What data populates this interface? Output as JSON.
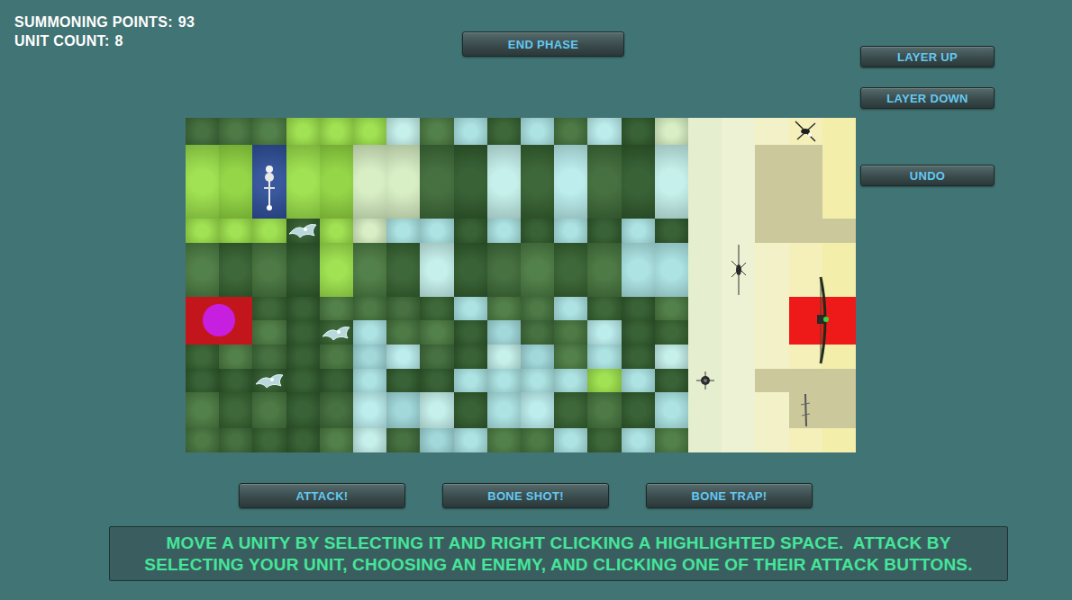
{
  "status": [
    {
      "label": "SUMMONING POINTS:",
      "value": "93"
    },
    {
      "label": "UNIT COUNT:",
      "value": "8"
    }
  ],
  "phase_button": "END PHASE",
  "side_buttons": [
    "LAYER UP",
    "LAYER DOWN",
    "UNDO"
  ],
  "board": {
    "rows": [
      [
        "grass",
        "grass",
        "grass",
        "move",
        "move",
        "move",
        "ice",
        "grass",
        "ice",
        "grass",
        "ice",
        "grass",
        "ice",
        "grass",
        "pale",
        "sand",
        "sand",
        "sand",
        "sand",
        "sand"
      ],
      [
        "move",
        "move",
        "select",
        "move",
        "move",
        "pale",
        "pale",
        "grass",
        "grass",
        "ice",
        "grass",
        "ice",
        "grass",
        "grass",
        "ice",
        "sand",
        "sand",
        "sand",
        "sand",
        "sand"
      ],
      [
        "move",
        "move",
        "move",
        "grass",
        "move",
        "pale",
        "ice",
        "ice",
        "grass",
        "ice",
        "grass",
        "ice",
        "grass",
        "ice",
        "grass",
        "sand",
        "sand",
        "sand",
        "sand",
        "sand"
      ],
      [
        "grass",
        "grass",
        "grass",
        "grass",
        "move",
        "grass",
        "grass",
        "ice",
        "grass",
        "grass",
        "grass",
        "grass",
        "grass",
        "ice",
        "ice",
        "sand",
        "sand",
        "sand",
        "sand",
        "sand"
      ],
      [
        "enemy",
        "enemy",
        "grass",
        "grass",
        "grass",
        "grass",
        "grass",
        "grass",
        "ice",
        "grass",
        "grass",
        "ice",
        "grass",
        "grass",
        "grass",
        "sand",
        "sand",
        "sand",
        "enemy",
        "enemy"
      ],
      [
        "enemy",
        "enemy",
        "grass",
        "grass",
        "grass",
        "ice",
        "grass",
        "grass",
        "grass",
        "ice",
        "grass",
        "grass",
        "ice",
        "grass",
        "grass",
        "sand",
        "sand",
        "sand",
        "enemy",
        "enemy"
      ],
      [
        "grass",
        "grass",
        "grass",
        "grass",
        "grass",
        "ice",
        "ice",
        "grass",
        "grass",
        "ice",
        "ice",
        "grass",
        "ice",
        "grass",
        "ice",
        "sand",
        "sand",
        "sand",
        "sand",
        "sand"
      ],
      [
        "grass",
        "grass",
        "grass",
        "grass",
        "grass",
        "ice",
        "grass",
        "grass",
        "ice",
        "ice",
        "ice",
        "ice",
        "move",
        "ice",
        "grass",
        "sand",
        "sand",
        "sand",
        "sand",
        "sand"
      ],
      [
        "grass",
        "grass",
        "grass",
        "grass",
        "grass",
        "ice",
        "ice",
        "ice",
        "grass",
        "ice",
        "ice",
        "grass",
        "grass",
        "grass",
        "ice",
        "sand",
        "sand",
        "sand",
        "sand",
        "sand"
      ],
      [
        "grass",
        "grass",
        "grass",
        "grass",
        "grass",
        "ice",
        "grass",
        "ice",
        "ice",
        "grass",
        "grass",
        "ice",
        "grass",
        "ice",
        "grass",
        "sand",
        "sand",
        "sand",
        "sand",
        "sand"
      ]
    ]
  },
  "units": [
    {
      "kind": "skeleton",
      "col": 2,
      "row": 1,
      "span": 1,
      "selected": true
    },
    {
      "kind": "ghost",
      "col": 3,
      "row": 2,
      "span": 1,
      "selected": false
    },
    {
      "kind": "orb",
      "col": 0,
      "row": 4,
      "span": 2,
      "selected": false
    },
    {
      "kind": "ghost",
      "col": 4,
      "row": 5,
      "span": 1,
      "selected": false
    },
    {
      "kind": "ghost",
      "col": 2,
      "row": 7,
      "span": 1,
      "selected": false
    },
    {
      "kind": "insect",
      "col": 18,
      "row": 0,
      "span": 1,
      "selected": false
    },
    {
      "kind": "spider",
      "col": 16,
      "row": 3,
      "span": 1,
      "selected": false
    },
    {
      "kind": "bow",
      "col": 18,
      "row": 4,
      "span": 2,
      "selected": false
    },
    {
      "kind": "beetle",
      "col": 15,
      "row": 7,
      "span": 1,
      "selected": false
    },
    {
      "kind": "stick",
      "col": 18,
      "row": 8,
      "span": 1,
      "selected": false
    }
  ],
  "action_buttons": [
    "ATTACK!",
    "BONE SHOT!",
    "BONE TRAP!"
  ],
  "instructions": "MOVE A UNITY BY SELECTING IT AND RIGHT CLICKING A HIGHLIGHTED SPACE.  ATTACK BY SELECTING YOUR UNIT, CHOOSING AN ENEMY, AND CLICKING ONE OF THEIR ATTACK BUTTONS."
}
